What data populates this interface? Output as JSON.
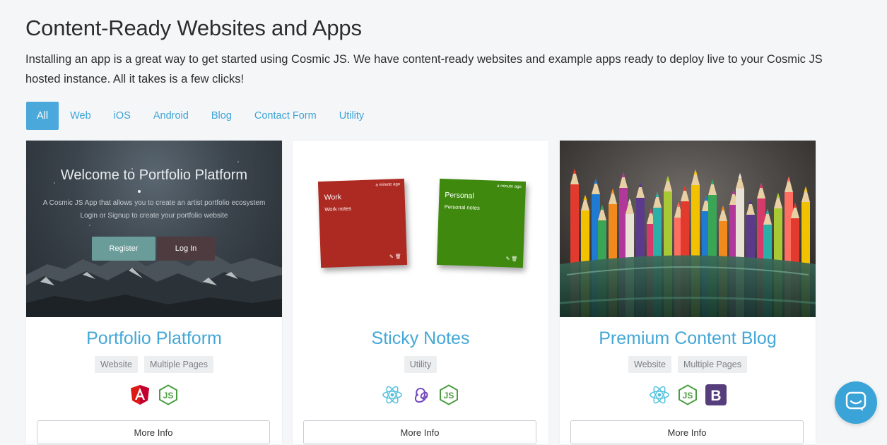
{
  "page": {
    "title": "Content-Ready Websites and Apps",
    "description": "Installing an app is a great way to get started using Cosmic JS. We have content-ready websites and example apps ready to deploy live to your Cosmic JS hosted instance. All it takes is a few clicks!"
  },
  "tabs": [
    {
      "label": "All",
      "active": true
    },
    {
      "label": "Web",
      "active": false
    },
    {
      "label": "iOS",
      "active": false
    },
    {
      "label": "Android",
      "active": false
    },
    {
      "label": "Blog",
      "active": false
    },
    {
      "label": "Contact Form",
      "active": false
    },
    {
      "label": "Utility",
      "active": false
    }
  ],
  "cards": [
    {
      "title": "Portfolio Platform",
      "tags": [
        "Website",
        "Multiple Pages"
      ],
      "tech_icons": [
        "angular-icon",
        "nodejs-icon"
      ],
      "more_label": "More Info",
      "preview": {
        "heading": "Welcome to Portfolio Platform",
        "subline1": "A Cosmic JS App that  allows you to create an artist portfolio ecosystem",
        "subline2": "Login or Signup to create your portfolio website",
        "register_label": "Register",
        "login_label": "Log In"
      }
    },
    {
      "title": "Sticky Notes",
      "tags": [
        "Utility"
      ],
      "tech_icons": [
        "react-icon",
        "redux-icon",
        "nodejs-icon"
      ],
      "more_label": "More Info",
      "preview": {
        "notes": [
          {
            "title": "Work",
            "body": "Work notes",
            "time": "a minute ago",
            "color": "#ad2a22"
          },
          {
            "title": "Personal",
            "body": "Personal notes",
            "time": "a minute ago",
            "color": "#3f8a0e"
          }
        ]
      }
    },
    {
      "title": "Premium Content Blog",
      "tags": [
        "Website",
        "Multiple Pages"
      ],
      "tech_icons": [
        "react-icon",
        "nodejs-icon",
        "bootstrap-icon"
      ],
      "more_label": "More Info"
    }
  ],
  "colors": {
    "accent": "#44a7d6",
    "tab_active_bg": "#4aa9da",
    "background": "#f5f6f8"
  }
}
